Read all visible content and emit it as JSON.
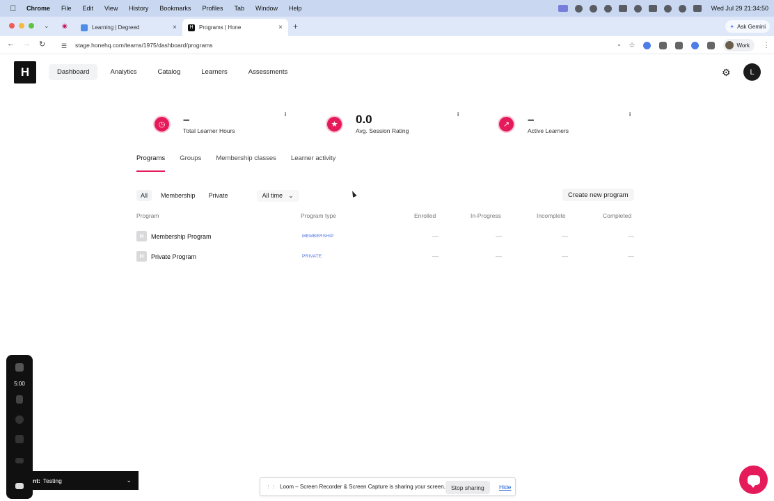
{
  "menubar": {
    "apple_icon": "apple-logo-icon",
    "items": [
      "Chrome",
      "File",
      "Edit",
      "View",
      "History",
      "Bookmarks",
      "Profiles",
      "Tab",
      "Window",
      "Help"
    ],
    "clock": "Wed Jul 29  21:34:50"
  },
  "browser": {
    "tabs": [
      {
        "title": "Learning | Degreed",
        "active": false
      },
      {
        "title": "Programs | Hone",
        "active": true
      }
    ],
    "new_tab": "+",
    "gemini_label": "Ask Gemini",
    "url": "stage.honehq.com/teams/1975/dashboard/programs",
    "profile_label": "Work"
  },
  "app": {
    "logo": "H",
    "nav": [
      "Dashboard",
      "Analytics",
      "Catalog",
      "Learners",
      "Assessments"
    ],
    "nav_active": "Dashboard",
    "avatar_initial": "L"
  },
  "stats": [
    {
      "value": "–",
      "label": "Total Learner Hours",
      "icon": "clock-icon",
      "info": "i"
    },
    {
      "value": "0.0",
      "label": "Avg. Session Rating",
      "icon": "star-icon",
      "info": "i"
    },
    {
      "value": "–",
      "label": "Active Learners",
      "icon": "trend-up-icon",
      "info": "i"
    }
  ],
  "subtabs": [
    "Programs",
    "Groups",
    "Membership classes",
    "Learner activity"
  ],
  "filters": {
    "options": [
      "All",
      "Membership",
      "Private"
    ],
    "active": "All",
    "time_range": "All time",
    "create_label": "Create new program"
  },
  "table": {
    "headers": [
      "Program",
      "Program type",
      "Enrolled",
      "In-Progress",
      "Incomplete",
      "Completed"
    ],
    "rows": [
      {
        "icon": "H",
        "name": "Membership Program",
        "type": "MEMBERSHIP",
        "enrolled": "—",
        "in_progress": "—",
        "incomplete": "—",
        "completed": "—"
      },
      {
        "icon": "H",
        "name": "Private Program",
        "type": "PRIVATE",
        "enrolled": "—",
        "in_progress": "—",
        "incomplete": "—",
        "completed": "—"
      }
    ]
  },
  "loom": {
    "timer": "5:00",
    "bar_label": "nt:",
    "bar_value": "Testing",
    "share_text": "Loom – Screen Recorder & Screen Capture is sharing your screen.",
    "stop_label": "Stop sharing",
    "hide_label": "Hide"
  },
  "colors": {
    "accent": "#e51a5b",
    "badge_blue": "#4a6ee0"
  }
}
